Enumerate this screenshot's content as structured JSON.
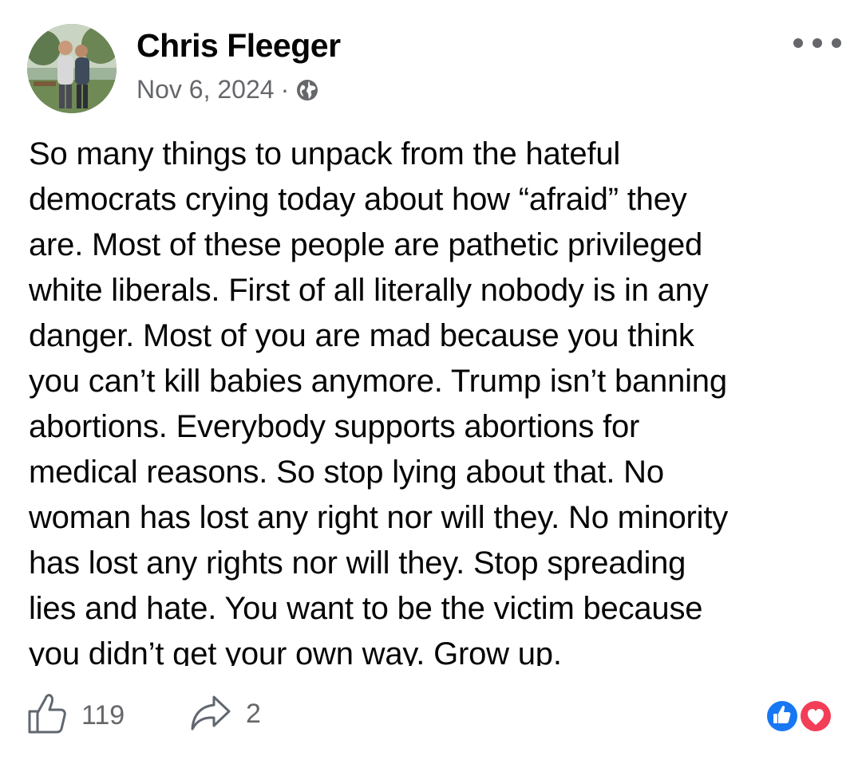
{
  "post": {
    "author": "Chris Fleeger",
    "date": "Nov 6, 2024",
    "separator": "·",
    "privacy_icon": "globe-icon",
    "more_icon": "more-horizontal-icon",
    "text": "So many things to unpack from the hateful\ndemocrats crying today about how “afraid” they\nare. Most of these people are pathetic privileged\nwhite liberals. First of all literally nobody is in any\ndanger. Most of you are mad because you think\nyou can’t kill babies anymore. Trump isn’t banning\nabortions. Everybody supports abortions for\nmedical reasons. So stop lying about that. No\nwoman has lost any right nor will they. No minority\nhas lost any rights nor will they. Stop spreading\nlies and hate. You want to be the victim because\nyou didn’t get your own way. Grow up."
  },
  "footer": {
    "like_icon": "thumbs-up-icon",
    "like_count": "119",
    "share_icon": "share-arrow-icon",
    "share_count": "2",
    "reactions": [
      "like-reaction-icon",
      "love-reaction-icon"
    ]
  },
  "colors": {
    "text": "#050505",
    "secondary": "#65676b",
    "like_blue": "#1877f2",
    "love_red": "#f33e58"
  }
}
